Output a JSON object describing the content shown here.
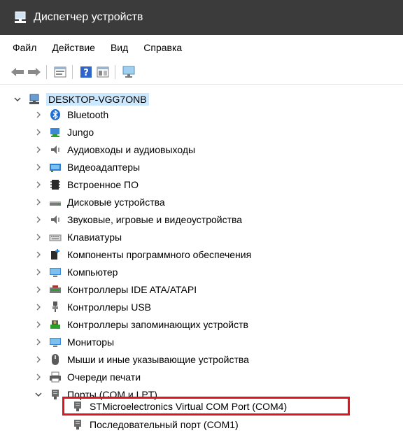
{
  "window": {
    "title": "Диспетчер устройств"
  },
  "menu": [
    "Файл",
    "Действие",
    "Вид",
    "Справка"
  ],
  "toolbar": {
    "buttons": [
      "back-arrow-icon",
      "forward-arrow-icon",
      "properties-icon",
      "help-icon",
      "update-driver-icon",
      "scan-hardware-icon"
    ]
  },
  "tree": {
    "root": "DESKTOP-VGG7ONB",
    "categories": [
      "Bluetooth",
      "Jungo",
      "Аудиовходы и аудиовыходы",
      "Видеоадаптеры",
      "Встроенное ПО",
      "Дисковые устройства",
      "Звуковые, игровые и видеоустройства",
      "Клавиатуры",
      "Компоненты программного обеспечения",
      "Компьютер",
      "Контроллеры IDE ATA/ATAPI",
      "Контроллеры USB",
      "Контроллеры запоминающих устройств",
      "Мониторы",
      "Мыши и иные указывающие устройства",
      "Очереди печати",
      "Порты (COM и LPT)"
    ],
    "ports": [
      "STMicroelectronics Virtual COM Port (COM4)",
      "Последовательный порт (COM1)"
    ]
  },
  "colors": {
    "highlight": "#e0141e",
    "titlebar": "#3b3b3b",
    "selection": "#cce8ff"
  }
}
